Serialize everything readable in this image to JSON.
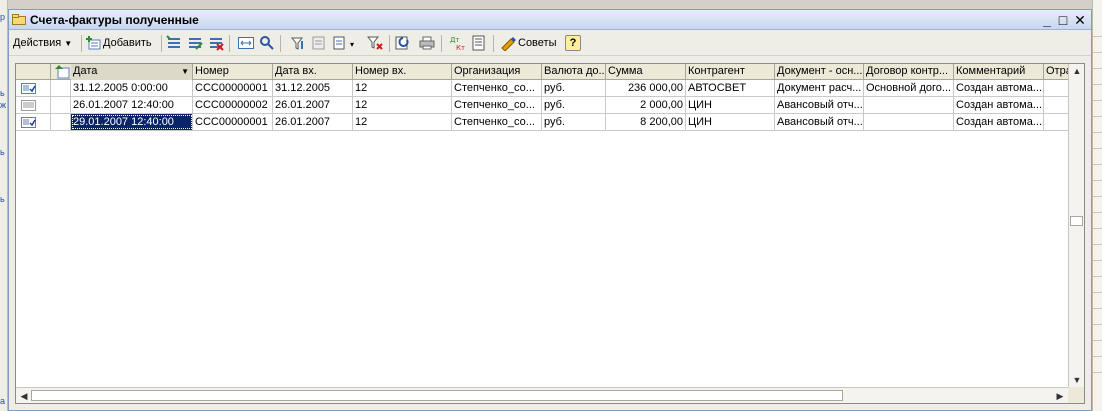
{
  "window": {
    "title": "Счета-фактуры полученные"
  },
  "window_controls": {
    "minimize": "_",
    "maximize": "□",
    "close": "✕"
  },
  "toolbar": {
    "actions_label": "Действия",
    "add_label": "Добавить",
    "add_accel": "Д",
    "tips_label": "Советы",
    "help_label": "?"
  },
  "columns": [
    "Дата",
    "Номер",
    "Дата вх.",
    "Номер вх.",
    "Организация",
    "Валюта до...",
    "Сумма",
    "Контрагент",
    "Документ - осн...",
    "Договор контр...",
    "Комментарий",
    "Отра"
  ],
  "rows": [
    {
      "status": "posted",
      "date": "31.12.2005 0:00:00",
      "number": "CCC00000001",
      "in_date": "31.12.2005",
      "in_number": "12",
      "org": "Степченко_со...",
      "currency": "руб.",
      "sum": "236 000,00",
      "counterparty": "АВТОСВЕТ",
      "basis_doc": "Документ расч...",
      "contract": "Основной дого...",
      "comment": "Создан автома...",
      "extra": ""
    },
    {
      "status": "draft",
      "date": "26.01.2007 12:40:00",
      "number": "CCC00000002",
      "in_date": "26.01.2007",
      "in_number": "12",
      "org": "Степченко_со...",
      "currency": "руб.",
      "sum": "2 000,00",
      "counterparty": "ЦИН",
      "basis_doc": "Авансовый отч...",
      "contract": "",
      "comment": "Создан автома...",
      "extra": ""
    },
    {
      "status": "posted",
      "date": "29.01.2007 12:40:00",
      "number": "CCC00000001",
      "in_date": "26.01.2007",
      "in_number": "12",
      "org": "Степченко_со...",
      "currency": "руб.",
      "sum": "8 200,00",
      "counterparty": "ЦИН",
      "basis_doc": "Авансовый отч...",
      "contract": "",
      "comment": "Создан автома...",
      "extra": ""
    }
  ],
  "selection": {
    "row": 2,
    "column": "date"
  },
  "colors": {
    "title_bar": "#c7d6ef",
    "selection": "#0a246a",
    "header": "#ece9d8"
  }
}
